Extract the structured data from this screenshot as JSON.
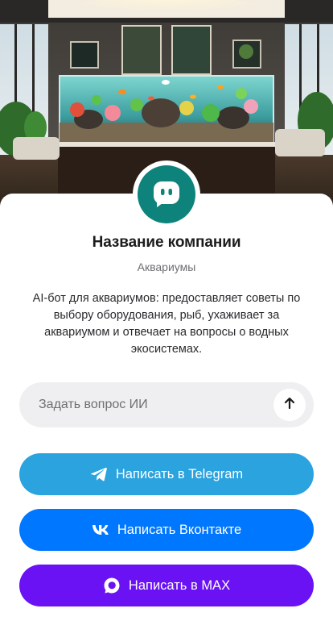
{
  "company": {
    "name": "Название компании",
    "category": "Аквариумы",
    "description": "AI-бот для аквариумов: предоставляет советы по выбору оборудования, рыб, ухаживает за аквариумом и отвечает на вопросы о водных экосистемах."
  },
  "ask": {
    "placeholder": "Задать вопрос ИИ",
    "value": ""
  },
  "buttons": {
    "telegram": "Написать в Telegram",
    "vk": "Написать Вконтакте",
    "max": "Написать в MAX"
  },
  "icons": {
    "avatar": "chat-bot-icon",
    "send": "arrow-up-icon",
    "telegram": "telegram-icon",
    "vk": "vk-icon",
    "max": "max-icon"
  },
  "colors": {
    "avatar_bg": "#0d837b",
    "telegram": "#2aa3df",
    "vk": "#0077ff",
    "max": "#6a12f3",
    "input_bg": "#efeff1"
  }
}
